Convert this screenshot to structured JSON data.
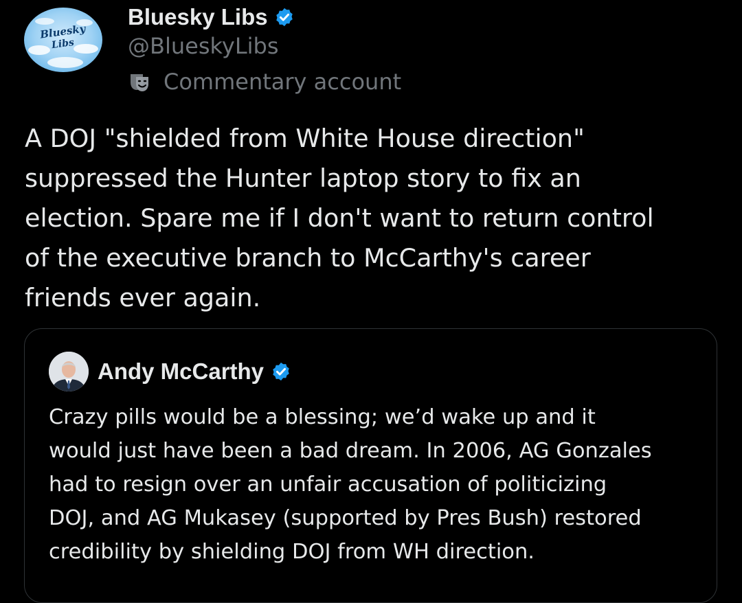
{
  "colors": {
    "background": "#000000",
    "text_primary": "#e7e9ea",
    "text_secondary": "#71767b",
    "verified_blue": "#1d9bf0",
    "card_border": "#2f3336"
  },
  "post": {
    "author": {
      "avatar_text": "Bluesky Libs",
      "display_name": "Bluesky Libs",
      "handle": "@BlueskyLibs",
      "verified_icon": "verified-badge-icon",
      "label_icon": "theater-masks-icon",
      "label": "Commentary account"
    },
    "text": "A DOJ \"shielded from White House direction\"\nsuppressed the Hunter laptop story to fix an\nelection. Spare me if I don't want to return control\nof the executive branch to McCarthy's career\nfriends ever again.",
    "quote": {
      "author": {
        "display_name": "Andy McCarthy",
        "verified_icon": "verified-badge-icon"
      },
      "text": "Crazy pills would be a blessing; we’d wake up and it\nwould just have been a bad dream. In 2006, AG Gonzales\nhad to resign over an unfair accusation of politicizing\nDOJ, and AG Mukasey (supported by Pres Bush) restored\ncredibility by shielding DOJ from WH direction."
    }
  }
}
